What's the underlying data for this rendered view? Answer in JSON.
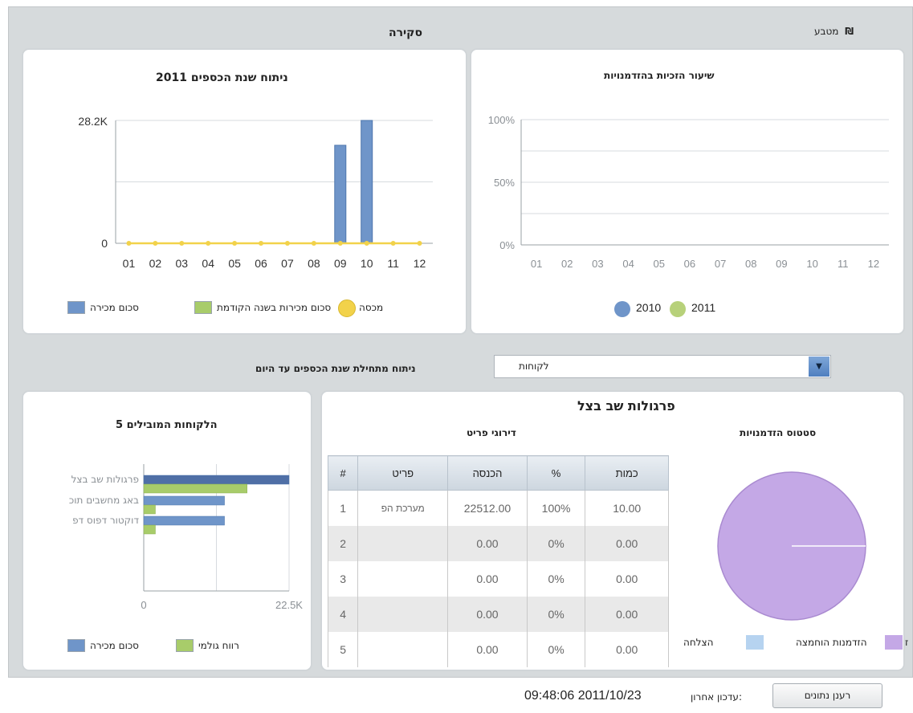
{
  "header": {
    "title": "סקירה",
    "currency_label": "מטבע",
    "currency_icon": "₪"
  },
  "chart_fiscal": {
    "title": "ניתוח שנת הכספים 2011",
    "legend": [
      "סכום מכירה",
      "סכום מכירות בשנה הקודמת",
      "מכסה"
    ],
    "colors": {
      "sales": "#6f95c9",
      "prev_year": "#a8cc6a",
      "quota": "#f2d24a"
    }
  },
  "chart_success": {
    "title": "שיעור הזכיות בהזדמנויות",
    "legend": [
      "2010",
      "2011"
    ],
    "colors": {
      "y2010": "#6f95c9",
      "y2011": "#b7d17a"
    }
  },
  "filter": {
    "label": "ניתוח מתחילת שנת הכספים עד היום",
    "select_value": "לקוחות",
    "dropdown_arrow": "▼"
  },
  "top_customers": {
    "title": "הלקוחות המובילים 5",
    "legend": [
      "סכום מכירה",
      "רווח גולמי"
    ],
    "colors": {
      "sales": "#6f95c9",
      "gross": "#a8cc6a"
    }
  },
  "customer_panel": {
    "title": "פרגולות שב בצל",
    "status_title": "סטטוס הזדמנויות",
    "items_title": "דירוגי פריט",
    "pie_legend": [
      "ז",
      "הזדמנות הוחמצה",
      "הצלחה"
    ],
    "pie_colors": {
      "z": "#c4a8e6",
      "missed": "#b6d3f0"
    },
    "table": {
      "headers": [
        "#",
        "פריט",
        "הכנסה",
        "%",
        "כמות"
      ],
      "rows": [
        [
          "1",
          "מערכת הפ",
          "22512.00",
          "100%",
          "10.00"
        ],
        [
          "2",
          "",
          "0.00",
          "0%",
          "0.00"
        ],
        [
          "3",
          "",
          "0.00",
          "0%",
          "0.00"
        ],
        [
          "4",
          "",
          "0.00",
          "0%",
          "0.00"
        ],
        [
          "5",
          "",
          "0.00",
          "0%",
          "0.00"
        ]
      ]
    }
  },
  "footer": {
    "refresh_button": "רענן נתונים",
    "last_update_label": "עדכון אחרון:",
    "last_update_value": "09:48:06 2011/10/23"
  },
  "chart_data": [
    {
      "type": "bar",
      "title": "ניתוח שנת הכספים 2011",
      "categories": [
        "01",
        "02",
        "03",
        "04",
        "05",
        "06",
        "07",
        "08",
        "09",
        "10",
        "11",
        "12"
      ],
      "y_tick_labels": [
        "28.2K",
        "0"
      ],
      "ylim": [
        0,
        28200
      ],
      "grid": true,
      "legend_position": "bottom",
      "series": [
        {
          "name": "סכום מכירה",
          "type": "bar",
          "values": [
            0,
            0,
            0,
            0,
            0,
            0,
            0,
            0,
            22500,
            28200,
            0,
            0
          ]
        },
        {
          "name": "סכום מכירות בשנה הקודמת",
          "type": "bar",
          "values": [
            0,
            0,
            0,
            0,
            0,
            0,
            0,
            0,
            0,
            0,
            0,
            0
          ]
        },
        {
          "name": "מכסה",
          "type": "line",
          "values": [
            0,
            0,
            0,
            0,
            0,
            0,
            0,
            0,
            0,
            0,
            0,
            0
          ]
        }
      ]
    },
    {
      "type": "line",
      "title": "שיעור הזכיות בהזדמנויות",
      "categories": [
        "01",
        "02",
        "03",
        "04",
        "05",
        "06",
        "07",
        "08",
        "09",
        "10",
        "11",
        "12"
      ],
      "y_tick_labels": [
        "100%",
        "50%",
        "0%"
      ],
      "ylim": [
        0,
        100
      ],
      "grid": true,
      "legend_position": "bottom",
      "series": [
        {
          "name": "2010",
          "values": []
        },
        {
          "name": "2011",
          "values": []
        }
      ]
    },
    {
      "type": "bar",
      "orientation": "horizontal",
      "title": "הלקוחות המובילים 5",
      "categories": [
        "פרגולות שב בצל",
        "באג מחשבים תוכ",
        "דוקטור דפוס דפ"
      ],
      "x_tick_labels": [
        "0",
        "22.5K"
      ],
      "xlim": [
        0,
        22500
      ],
      "legend_position": "bottom",
      "series": [
        {
          "name": "סכום מכירה",
          "values": [
            22500,
            12500,
            12500
          ]
        },
        {
          "name": "רווח גולמי",
          "values": [
            16000,
            1800,
            1800
          ]
        }
      ]
    },
    {
      "type": "pie",
      "title": "סטטוס הזדמנויות",
      "categories": [
        "ז",
        "הזדמנות הוחמצה",
        "הצלחה"
      ],
      "values": [
        100,
        0,
        0
      ]
    }
  ]
}
